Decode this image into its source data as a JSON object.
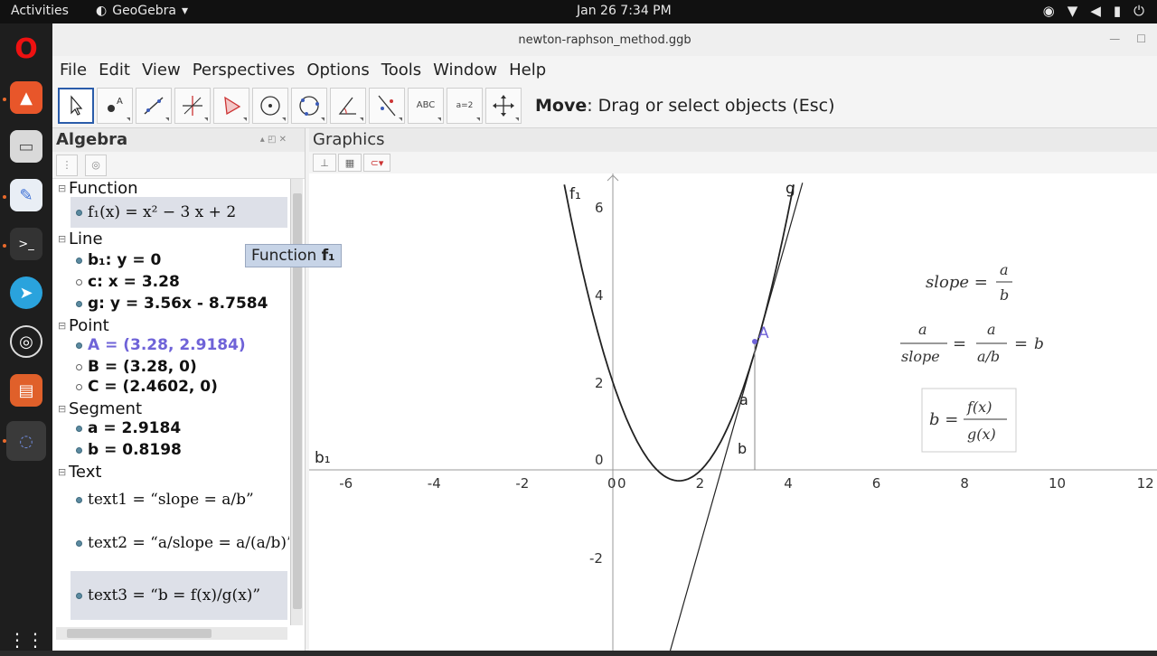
{
  "topbar": {
    "activities": "Activities",
    "app_name": "GeoGebra",
    "clock": "Jan 26  7:34 PM"
  },
  "window": {
    "title": "newton-raphson_method.ggb"
  },
  "menu": [
    "File",
    "Edit",
    "View",
    "Perspectives",
    "Options",
    "Tools",
    "Window",
    "Help"
  ],
  "toolbar": {
    "tools": [
      "move-tool-icon",
      "point-tool-icon",
      "line-tool-icon",
      "perpendicular-tool-icon",
      "polygon-tool-icon",
      "circle-tool-icon",
      "circle-three-points-icon",
      "angle-tool-icon",
      "reflect-tool-icon",
      "text-tool-icon",
      "slider-tool-icon",
      "move-graphics-icon"
    ],
    "text_tool_label": "ABC",
    "slider_tool_label": "a=2",
    "help_bold": "Move",
    "help_text": ": Drag or select objects (Esc)"
  },
  "algebra": {
    "title": "Algebra",
    "categories": {
      "function": "Function",
      "line": "Line",
      "point": "Point",
      "segment": "Segment",
      "text": "Text"
    },
    "items": {
      "f1": "f₁(x) = x² − 3 x + 2",
      "b1": "b₁: y = 0",
      "c": "c: x = 3.28",
      "g": "g: y = 3.56x - 8.7584",
      "A": "A = (3.28, 2.9184)",
      "B": "B = (3.28, 0)",
      "C": "C = (2.4602, 0)",
      "a": "a = 2.9184",
      "b": "b = 0.8198",
      "text1": "text1 = “slope = a/b”",
      "text2": "text2 = “a/slope = a/(a/b)”",
      "text3": "text3 = “b = f(x)/g(x)”"
    }
  },
  "tooltip": {
    "prefix": "Function ",
    "name": "f₁"
  },
  "graphics": {
    "title": "Graphics",
    "x_ticks": [
      "-6",
      "-4",
      "-2",
      "0",
      "2",
      "4",
      "6",
      "8",
      "10",
      "12"
    ],
    "y_ticks": [
      "6",
      "4",
      "2",
      "-2"
    ],
    "labels": {
      "f1": "f₁",
      "g": "g",
      "A": "A",
      "a": "a",
      "b": "b",
      "b1": "b₁"
    },
    "formulas": {
      "slope_lhs": "slope =",
      "a": "a",
      "b": "b",
      "slope": "slope",
      "a_over_b": "a/b",
      "eq": "=",
      "b_eq": "b =",
      "fx": "f(x)",
      "gx": "g(x)"
    }
  },
  "colors": {
    "point_A": "#6f63d8",
    "accent": "#2a5caa"
  }
}
